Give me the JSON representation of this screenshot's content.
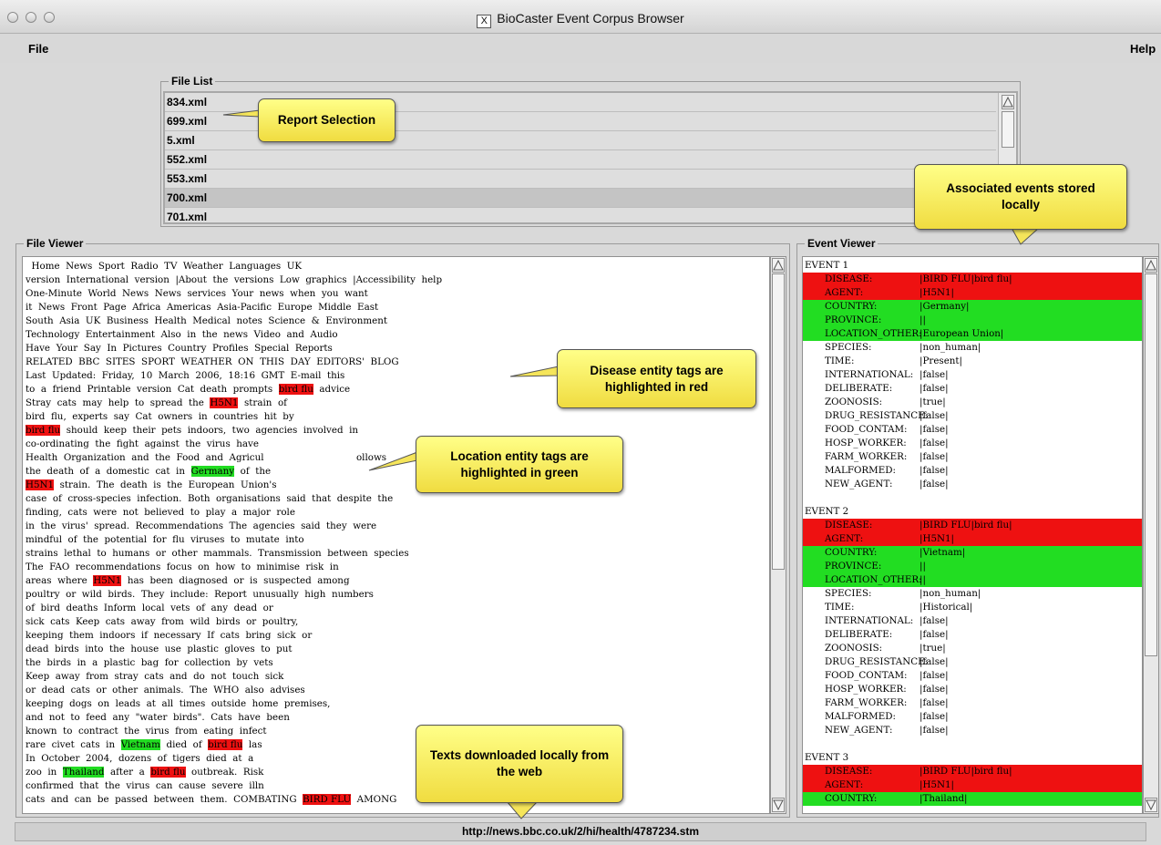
{
  "window": {
    "title": "BioCaster Event Corpus Browser",
    "x_glyph": "X"
  },
  "menu": {
    "file": "File",
    "help": "Help"
  },
  "file_list": {
    "title": "File List",
    "items": [
      "834.xml",
      "699.xml",
      "5.xml",
      "552.xml",
      "553.xml",
      "700.xml",
      "701.xml"
    ],
    "selected": "700.xml"
  },
  "file_viewer": {
    "title": "File Viewer",
    "lines": [
      [
        {
          "t": "  Home  News  Sport  Radio  TV  Weather  Languages  UK"
        }
      ],
      [
        {
          "t": "version  International  version  |About  the  versions  Low  graphics  |Accessibility  help"
        }
      ],
      [
        {
          "t": "One-Minute  World  News  News  services  Your  news  when  you  want"
        }
      ],
      [
        {
          "t": "it  News  Front  Page  Africa  Americas  Asia-Pacific  Europe  Middle  East"
        }
      ],
      [
        {
          "t": "South  Asia  UK  Business  Health  Medical  notes  Science  &  Environment"
        }
      ],
      [
        {
          "t": "Technology  Entertainment  Also  in  the  news  Video  and  Audio"
        }
      ],
      [
        {
          "t": "Have  Your  Say  In  Pictures  Country  Profiles  Special  Reports"
        }
      ],
      [
        {
          "t": "RELATED  BBC  SITES  SPORT  WEATHER  ON  THIS  DAY  EDITORS'  BLOG"
        }
      ],
      [
        {
          "t": "Last  Updated:  Friday,  10  March  2006,  18:16  GMT  E-mail  this"
        }
      ],
      [
        {
          "t": "to  a  friend  Printable  version  Cat  death  prompts  "
        },
        {
          "t": "bird flu",
          "c": "red"
        },
        {
          "t": "  advice"
        }
      ],
      [
        {
          "t": "Stray  cats  may  help  to  spread  the  "
        },
        {
          "t": "H5N1",
          "c": "red"
        },
        {
          "t": "  strain  of"
        }
      ],
      [
        {
          "t": "bird  flu,  experts  say  Cat  owners  in  countries  hit  by"
        }
      ],
      [
        {
          "t": "bird flu",
          "c": "red"
        },
        {
          "t": "  should  keep  their  pets  indoors,  two  agencies  involved  in"
        }
      ],
      [
        {
          "t": "co-ordinating  the  fight  against  the  virus  have"
        }
      ],
      [
        {
          "t": "Health  Organization  and  the  Food  and  Agricul                               ollows"
        }
      ],
      [
        {
          "t": "the  death  of  a  domestic  cat  in  "
        },
        {
          "t": "Germany",
          "c": "green"
        },
        {
          "t": "  of  the"
        }
      ],
      [
        {
          "t": "H5N1",
          "c": "red"
        },
        {
          "t": "  strain.  The  death  is  the  European  Union's"
        }
      ],
      [
        {
          "t": "case  of  cross-species  infection.  Both  organisations  said  that  despite  the"
        }
      ],
      [
        {
          "t": "finding,  cats  were  not  believed  to  play  a  major  role"
        }
      ],
      [
        {
          "t": "in  the  virus'  spread.  Recommendations  The  agencies  said  they  were"
        }
      ],
      [
        {
          "t": "mindful  of  the  potential  for  flu  viruses  to  mutate  into"
        }
      ],
      [
        {
          "t": "strains  lethal  to  humans  or  other  mammals.  Transmission  between  species"
        }
      ],
      [
        {
          "t": "The  FAO  recommendations  focus  on  how  to  minimise  risk  in"
        }
      ],
      [
        {
          "t": "areas  where  "
        },
        {
          "t": "H5N1",
          "c": "red"
        },
        {
          "t": "  has  been  diagnosed  or  is  suspected  among"
        }
      ],
      [
        {
          "t": "poultry  or  wild  birds.  They  include:  Report  unusually  high  numbers"
        }
      ],
      [
        {
          "t": "of  bird  deaths  Inform  local  vets  of  any  dead  or"
        }
      ],
      [
        {
          "t": "sick  cats  Keep  cats  away  from  wild  birds  or  poultry,"
        }
      ],
      [
        {
          "t": "keeping  them  indoors  if  necessary  If  cats  bring  sick  or"
        }
      ],
      [
        {
          "t": "dead  birds  into  the  house  use  plastic  gloves  to  put"
        }
      ],
      [
        {
          "t": "the  birds  in  a  plastic  bag  for  collection  by  vets"
        }
      ],
      [
        {
          "t": "Keep  away  from  stray  cats  and  do  not  touch  sick"
        }
      ],
      [
        {
          "t": "or  dead  cats  or  other  animals.  The  WHO  also  advises"
        }
      ],
      [
        {
          "t": "keeping  dogs  on  leads  at  all  times  outside  home  premises,"
        }
      ],
      [
        {
          "t": "and  not  to  feed  any  \"water  birds\".  Cats  have  been"
        }
      ],
      [
        {
          "t": "known  to  contract  the  virus  from  eating  infect"
        }
      ],
      [
        {
          "t": "rare  civet  cats  in  "
        },
        {
          "t": "Vietnam",
          "c": "green"
        },
        {
          "t": "  died  of  "
        },
        {
          "t": "bird flu",
          "c": "red"
        },
        {
          "t": "  las"
        }
      ],
      [
        {
          "t": "In  October  2004,  dozens  of  tigers  died  at  a"
        }
      ],
      [
        {
          "t": "zoo  in  "
        },
        {
          "t": "Thailand",
          "c": "green"
        },
        {
          "t": "  after  a  "
        },
        {
          "t": "bird flu",
          "c": "red"
        },
        {
          "t": "  outbreak.  Risk"
        }
      ],
      [
        {
          "t": "confirmed  that  the  virus  can  cause  severe  illn"
        }
      ],
      [
        {
          "t": "cats  and  can  be  passed  between  them.  COMBATING  "
        },
        {
          "t": "BIRD FLU",
          "c": "red"
        },
        {
          "t": "  AMONG"
        }
      ]
    ]
  },
  "event_viewer": {
    "title": "Event Viewer",
    "events": [
      {
        "header": "EVENT 1",
        "rows": [
          {
            "k": "DISEASE:",
            "v": "|BIRD FLU|bird flu|",
            "c": "red"
          },
          {
            "k": "AGENT:",
            "v": "|H5N1|",
            "c": "red"
          },
          {
            "k": "COUNTRY:",
            "v": "|Germany|",
            "c": "green"
          },
          {
            "k": "PROVINCE:",
            "v": "||",
            "c": "green"
          },
          {
            "k": "LOCATION_OTHER:",
            "v": "|European Union|",
            "c": "green"
          },
          {
            "k": "SPECIES:",
            "v": "|non_human|"
          },
          {
            "k": "TIME:",
            "v": "|Present|"
          },
          {
            "k": "INTERNATIONAL:",
            "v": "|false|"
          },
          {
            "k": "DELIBERATE:",
            "v": "|false|"
          },
          {
            "k": "ZOONOSIS:",
            "v": "|true|"
          },
          {
            "k": "DRUG_RESISTANCE:",
            "v": "|false|"
          },
          {
            "k": "FOOD_CONTAM:",
            "v": "|false|"
          },
          {
            "k": "HOSP_WORKER:",
            "v": "|false|"
          },
          {
            "k": "FARM_WORKER:",
            "v": "|false|"
          },
          {
            "k": "MALFORMED:",
            "v": "|false|"
          },
          {
            "k": "NEW_AGENT:",
            "v": "|false|"
          }
        ]
      },
      {
        "header": "EVENT 2",
        "rows": [
          {
            "k": "DISEASE:",
            "v": "|BIRD FLU|bird flu|",
            "c": "red"
          },
          {
            "k": "AGENT:",
            "v": "|H5N1|",
            "c": "red"
          },
          {
            "k": "COUNTRY:",
            "v": "|Vietnam|",
            "c": "green"
          },
          {
            "k": "PROVINCE:",
            "v": "||",
            "c": "green"
          },
          {
            "k": "LOCATION_OTHER:",
            "v": "||",
            "c": "green"
          },
          {
            "k": "SPECIES:",
            "v": "|non_human|"
          },
          {
            "k": "TIME:",
            "v": "|Historical|"
          },
          {
            "k": "INTERNATIONAL:",
            "v": "|false|"
          },
          {
            "k": "DELIBERATE:",
            "v": "|false|"
          },
          {
            "k": "ZOONOSIS:",
            "v": "|true|"
          },
          {
            "k": "DRUG_RESISTANCE:",
            "v": "|false|"
          },
          {
            "k": "FOOD_CONTAM:",
            "v": "|false|"
          },
          {
            "k": "HOSP_WORKER:",
            "v": "|false|"
          },
          {
            "k": "FARM_WORKER:",
            "v": "|false|"
          },
          {
            "k": "MALFORMED:",
            "v": "|false|"
          },
          {
            "k": "NEW_AGENT:",
            "v": "|false|"
          }
        ]
      },
      {
        "header": "EVENT 3",
        "rows": [
          {
            "k": "DISEASE:",
            "v": "|BIRD FLU|bird flu|",
            "c": "red"
          },
          {
            "k": "AGENT:",
            "v": "|H5N1|",
            "c": "red"
          },
          {
            "k": "COUNTRY:",
            "v": "|Thailand|",
            "c": "green"
          }
        ]
      }
    ]
  },
  "status": {
    "url": "http://news.bbc.co.uk/2/hi/health/4787234.stm"
  },
  "callouts": {
    "report_selection": "Report Selection",
    "associated_events": "Associated events stored locally",
    "disease_tags": "Disease entity tags are highlighted in red",
    "location_tags": "Location entity tags are highlighted in green",
    "texts_downloaded": "Texts downloaded locally from the web"
  },
  "colors": {
    "disease": "#ee1111",
    "location": "#22dd22",
    "callout": "#f7ea58"
  },
  "icons": [
    "x11-icon",
    "window-close-icon",
    "window-minimize-icon",
    "window-zoom-icon",
    "scroll-up-arrow-icon",
    "scroll-down-arrow-icon"
  ]
}
